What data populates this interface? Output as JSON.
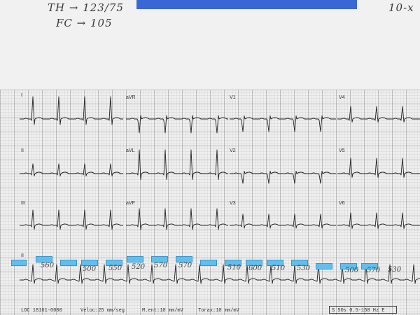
{
  "handwriting": {
    "line1_left": "TH → 123/75",
    "line2": "FC → 105",
    "line1_right": "10-x"
  },
  "leads": [
    "I",
    "aVR",
    "V1",
    "V4",
    "II",
    "aVL",
    "V2",
    "V5",
    "III",
    "aVF",
    "V3",
    "V6",
    "II"
  ],
  "rr_values": [
    "560",
    "500",
    "550",
    "520",
    "570",
    "570",
    "510",
    "600",
    "510",
    "530",
    "500",
    "570",
    "530"
  ],
  "footer": {
    "loc": "LOC 18101-0000",
    "speed": "Veloc:25 mm/seg",
    "limb": "M.ent:10 mm/mV",
    "chest": "Torax:10 mm/mV",
    "filter": "S 50s 0.5-150 Hz E"
  },
  "colors": {
    "redaction": "#3a67d6",
    "marker": "#5fc0f0",
    "trace": "#222222"
  }
}
